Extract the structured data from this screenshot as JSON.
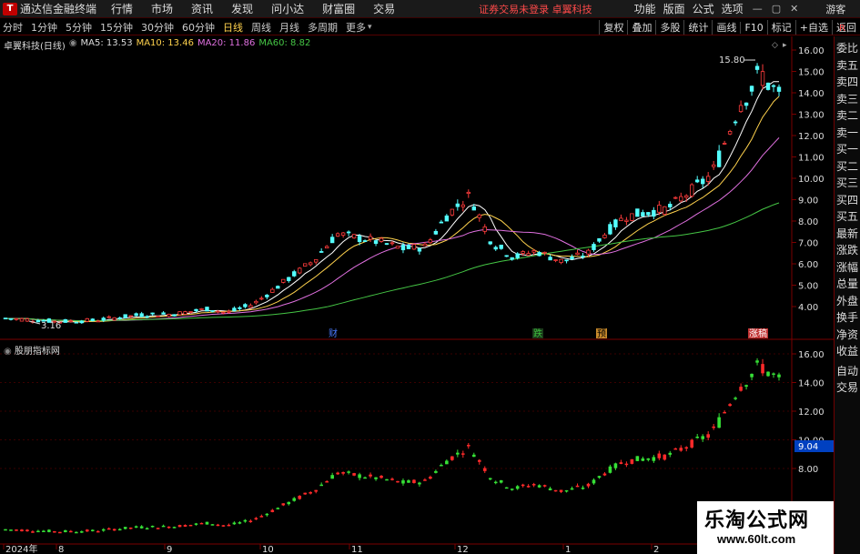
{
  "menubar": {
    "app_title": "通达信金融终端",
    "items": [
      "行情",
      "市场",
      "资讯",
      "发现",
      "问小达",
      "财富圈",
      "交易"
    ],
    "notice": "证券交易未登录  卓翼科技",
    "right_items": [
      "功能",
      "版面",
      "公式",
      "选项"
    ],
    "guest": "游客"
  },
  "periods": {
    "items": [
      "分时",
      "1分钟",
      "5分钟",
      "15分钟",
      "30分钟",
      "60分钟",
      "日线",
      "周线",
      "月线",
      "多周期",
      "更多"
    ],
    "active": "日线",
    "tools": [
      "复权",
      "叠加",
      "多股",
      "统计",
      "画线",
      "F10",
      "标记",
      "+自选",
      "返回"
    ]
  },
  "main_chart": {
    "stock_label": "卓翼科技(日线)",
    "ma5_label": "MA5: 13.53",
    "ma10_label": "MA10: 13.46",
    "ma20_label": "MA20: 11.86",
    "ma60_label": "MA60: 8.82",
    "high_label": "15.80",
    "low_label": "3.16",
    "yaxis": [
      "16.00",
      "15.00",
      "14.00",
      "13.00",
      "12.00",
      "11.00",
      "10.00",
      "9.00",
      "8.00",
      "7.00",
      "6.00",
      "5.00",
      "4.00"
    ],
    "event_tags": [
      {
        "label": "财",
        "color": "#4a7bff"
      },
      {
        "label": "跌",
        "color": "#3cbf3c"
      },
      {
        "label": "预",
        "color": "#c98a2b"
      },
      {
        "label": "涨稿",
        "color": "#e03030"
      }
    ]
  },
  "sub_chart": {
    "label": "股朋指标网",
    "yaxis": [
      "16.00",
      "14.00",
      "12.00",
      "10.00",
      "8.00"
    ],
    "current_value": "9.04"
  },
  "xaxis": [
    "2024年",
    "8",
    "9",
    "10",
    "11",
    "12",
    "1",
    "2"
  ],
  "right_panel": [
    "委比",
    "卖五",
    "卖四",
    "卖三",
    "卖二",
    "卖一",
    "买一",
    "买二",
    "买三",
    "买四",
    "买五",
    "最新",
    "涨跌",
    "涨幅",
    "总量",
    "外盘",
    "换手",
    "净资",
    "收益"
  ],
  "right_panel_bottom": [
    "自动",
    "交易"
  ],
  "watermark": {
    "line1": "乐淘公式网",
    "line2": "www.60lt.com"
  },
  "colors": {
    "up": "#ff3c3c",
    "down": "#54ffff",
    "sub_up": "#ff2a2a",
    "sub_down": "#36e036",
    "axis": "#7a0000"
  }
}
